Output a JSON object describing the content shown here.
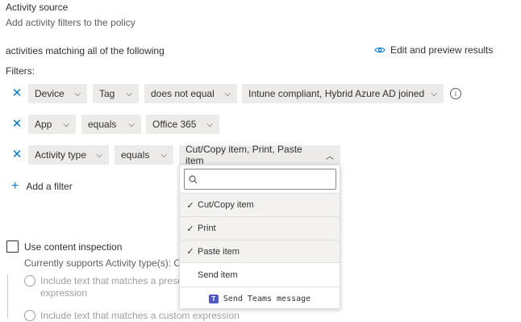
{
  "header": {
    "title": "Activity source",
    "subtitle": "Add activity filters to the policy"
  },
  "conditions": {
    "match_label": "activities matching all of the following",
    "edit_link": "Edit and preview results",
    "filters_label": "Filters:"
  },
  "filters": [
    {
      "field": "Device",
      "property": "Tag",
      "operator": "does not equal",
      "value": "Intune compliant, Hybrid Azure AD joined"
    },
    {
      "field": "App",
      "operator": "equals",
      "value": "Office 365"
    },
    {
      "field": "Activity type",
      "operator": "equals",
      "value": "Cut/Copy item, Print, Paste item"
    }
  ],
  "add_filter_label": "Add a filter",
  "dropdown": {
    "search_placeholder": "",
    "options": [
      {
        "label": "Cut/Copy item",
        "selected": true
      },
      {
        "label": "Print",
        "selected": true
      },
      {
        "label": "Paste item",
        "selected": true
      },
      {
        "label": "Send item",
        "selected": false
      }
    ],
    "teams_label": "Send Teams message",
    "teams_icon": "teams-icon"
  },
  "content_inspection": {
    "label": "Use content inspection",
    "checked": false,
    "support_text": "Currently supports Activity type(s): Cut/",
    "options": [
      {
        "label_line1": "Include text that matches a preset",
        "label_line2": "expression"
      },
      {
        "label_line1": "Include text that matches a custom expression"
      }
    ]
  },
  "colors": {
    "accent": "#0078d4",
    "dropdown_bg": "#edebe9",
    "text": "#323130",
    "secondary_text": "#605e5c"
  }
}
